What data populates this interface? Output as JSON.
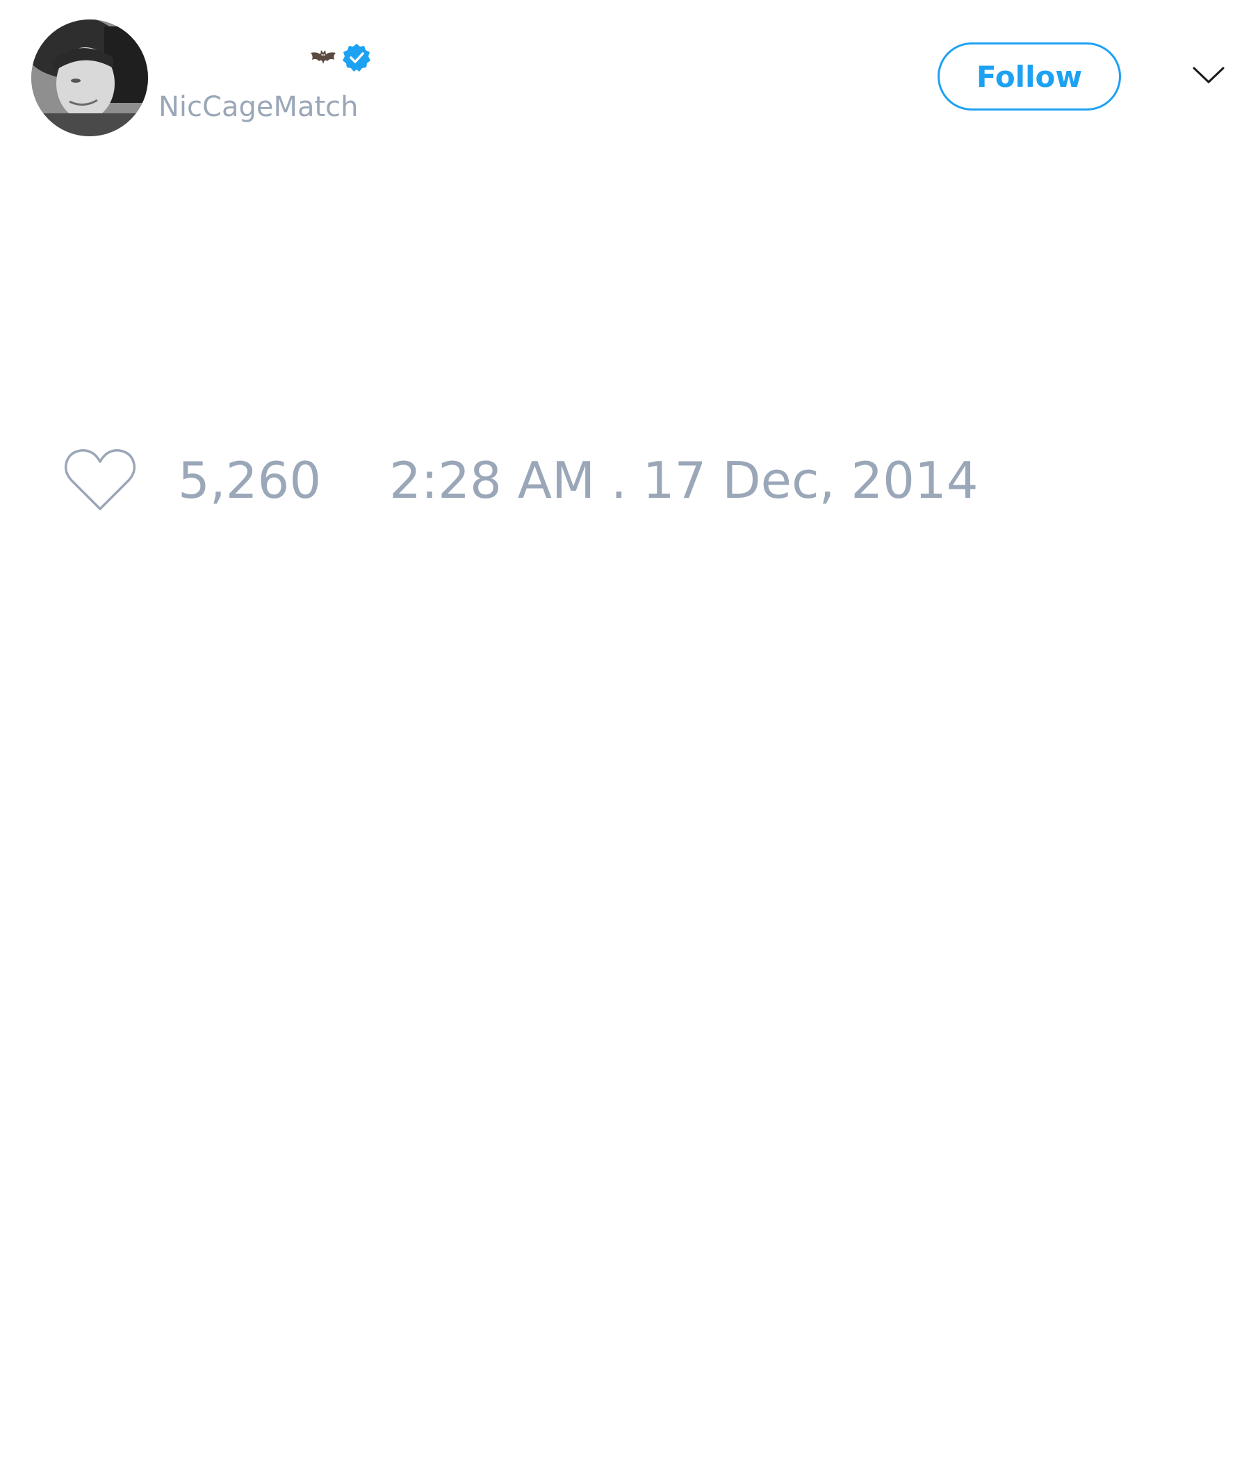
{
  "author": {
    "display_name_emoji": "bat-emoji",
    "verified": true,
    "verified_icon": "verified-badge-icon",
    "handle": "NicCageMatch",
    "avatar": "profile-photo"
  },
  "actions": {
    "follow_label": "Follow",
    "menu_icon": "chevron-down-icon"
  },
  "stats": {
    "like_icon": "heart-icon",
    "like_count": "5,260",
    "timestamp": "2:28 AM . 17 Dec, 2014"
  },
  "colors": {
    "accent": "#1da1f2",
    "muted_text": "#9aa7b8",
    "background": "#ffffff"
  }
}
